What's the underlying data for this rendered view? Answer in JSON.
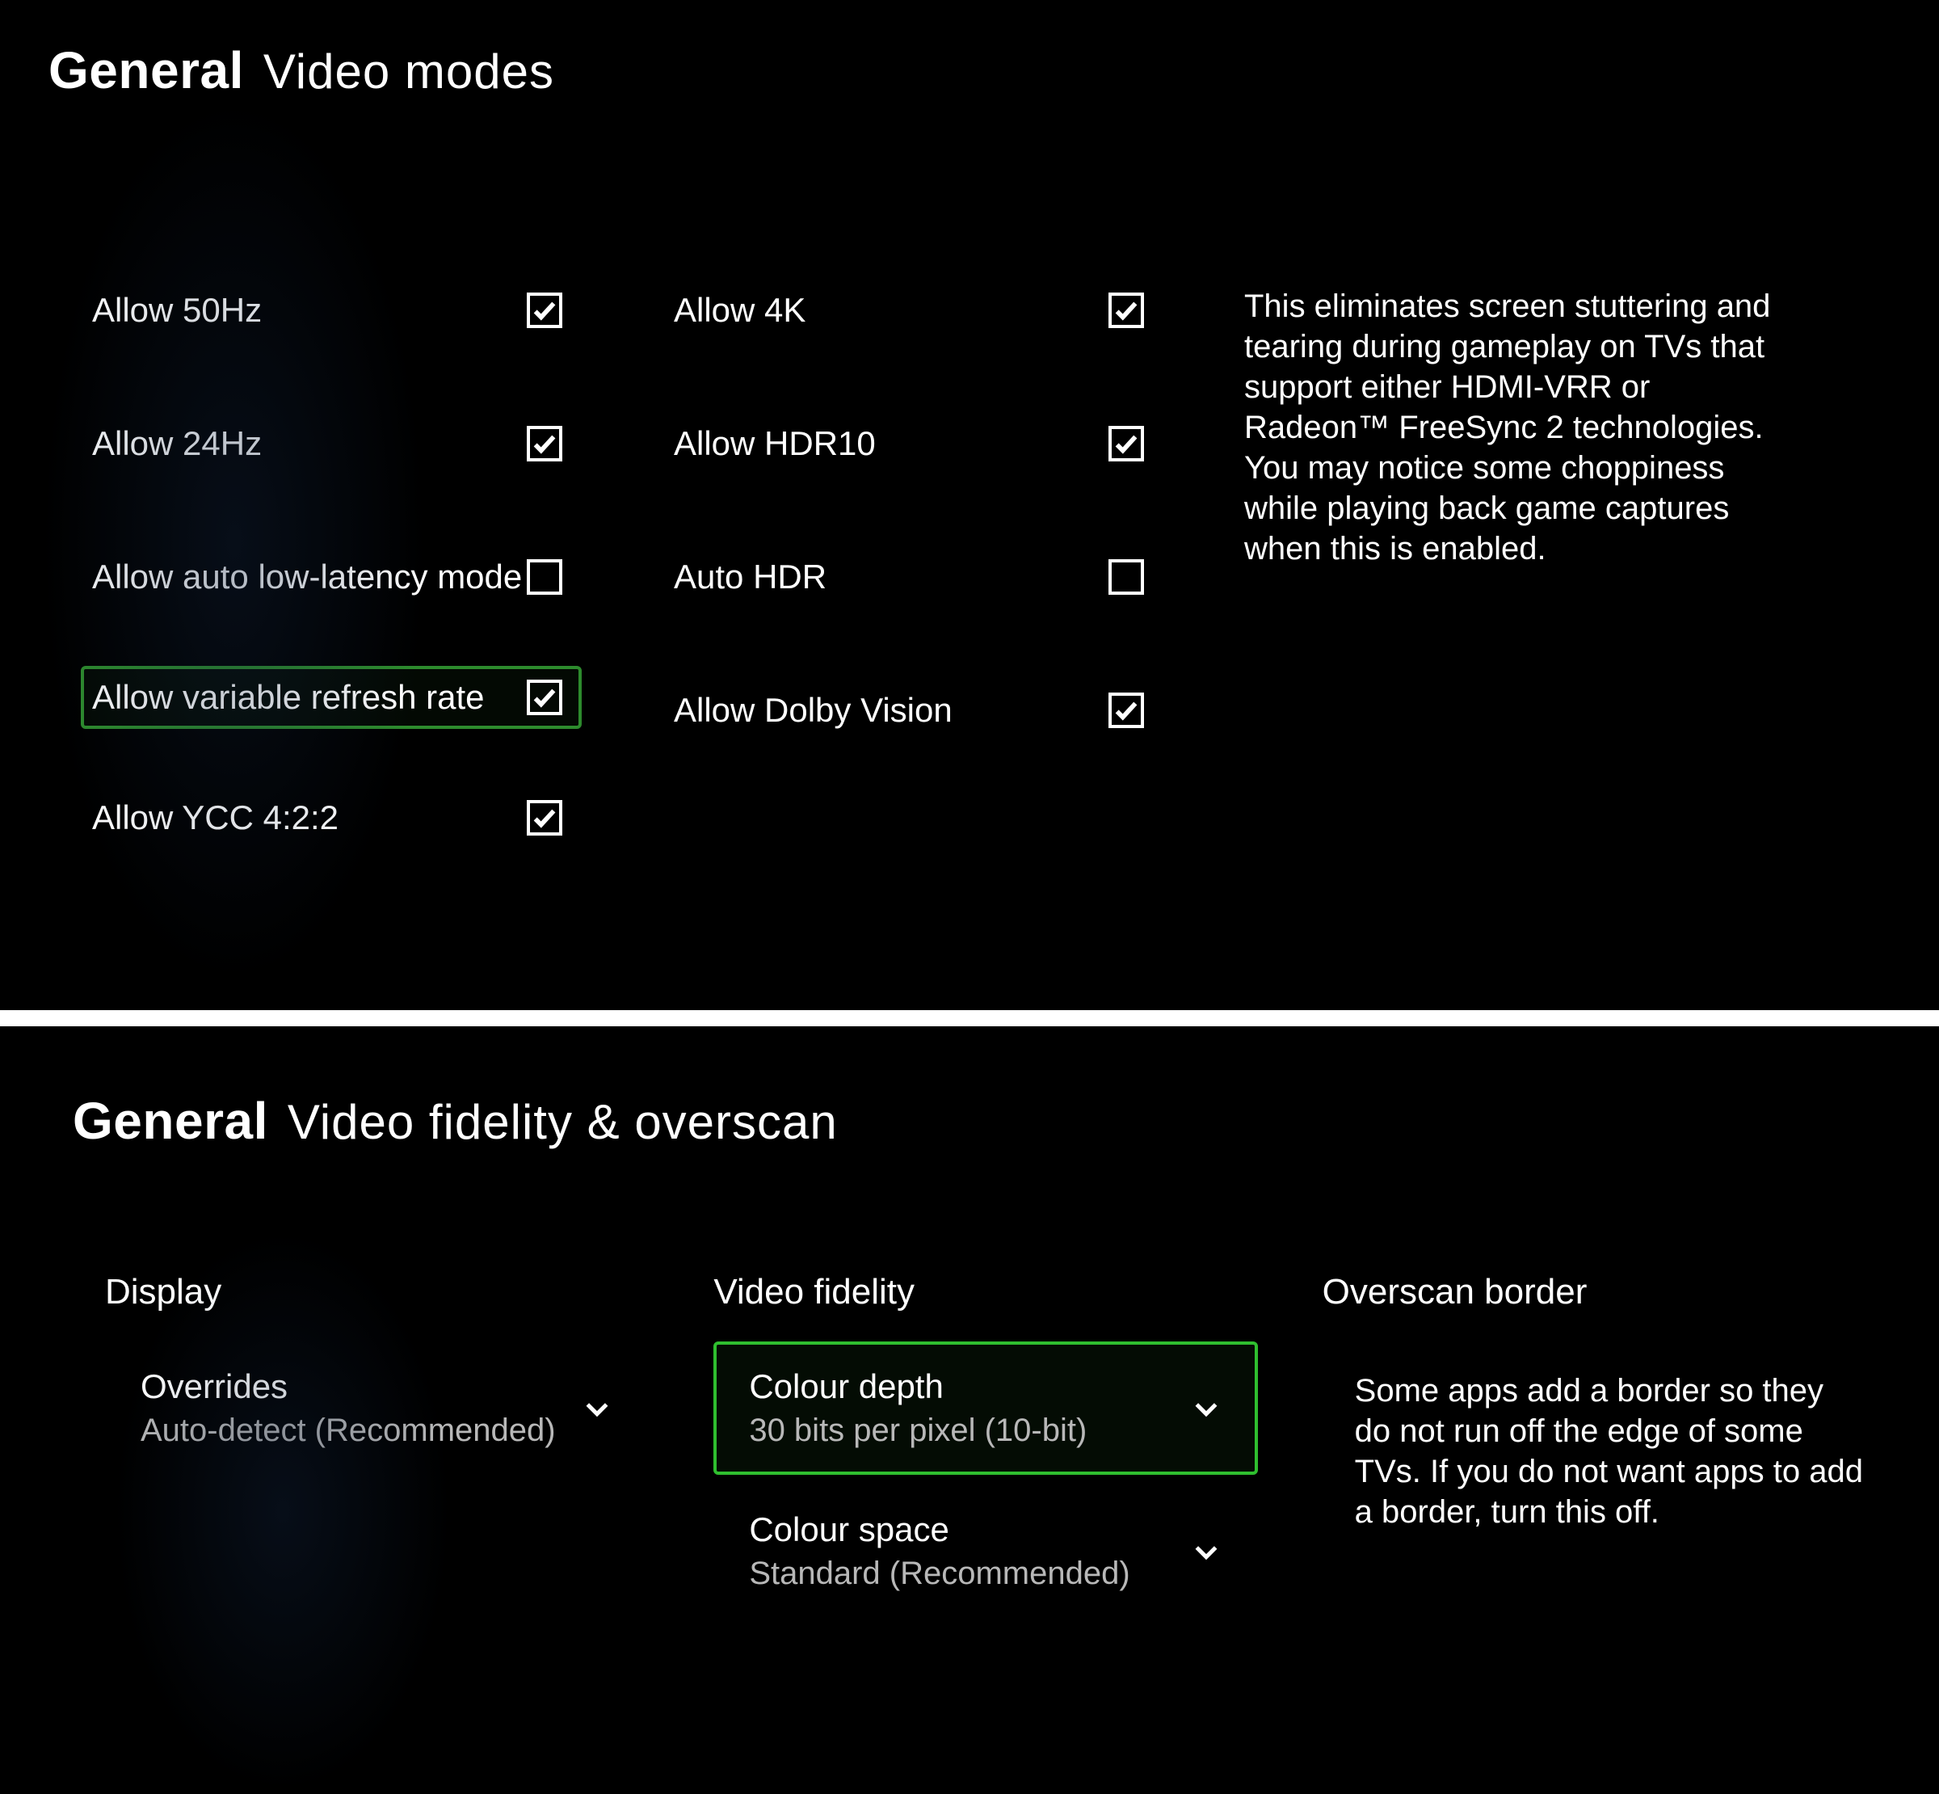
{
  "top": {
    "breadcrumb_main": "General",
    "breadcrumb_sub": "Video modes",
    "col1": [
      {
        "label": "Allow 50Hz",
        "checked": true,
        "highlighted": false
      },
      {
        "label": "Allow 24Hz",
        "checked": true,
        "highlighted": false
      },
      {
        "label": "Allow auto low-latency mode",
        "checked": false,
        "highlighted": false
      },
      {
        "label": "Allow variable refresh rate",
        "checked": true,
        "highlighted": true
      },
      {
        "label": "Allow YCC 4:2:2",
        "checked": true,
        "highlighted": false
      }
    ],
    "col2": [
      {
        "label": "Allow 4K",
        "checked": true,
        "highlighted": false
      },
      {
        "label": "Allow HDR10",
        "checked": true,
        "highlighted": false
      },
      {
        "label": "Auto HDR",
        "checked": false,
        "highlighted": false
      },
      {
        "label": "Allow Dolby Vision",
        "checked": true,
        "highlighted": false
      }
    ],
    "description": "This eliminates screen stuttering and tearing during gameplay on TVs that support either HDMI-VRR or Radeon™ FreeSync 2 technologies. You may notice some choppiness while playing back game captures when this is enabled."
  },
  "bottom": {
    "breadcrumb_main": "General",
    "breadcrumb_sub": "Video fidelity & overscan",
    "display": {
      "title": "Display",
      "overrides": {
        "label": "Overrides",
        "value": "Auto-detect (Recommended)",
        "highlighted": false
      }
    },
    "fidelity": {
      "title": "Video fidelity",
      "colour_depth": {
        "label": "Colour depth",
        "value": "30 bits per pixel (10-bit)",
        "highlighted": true
      },
      "colour_space": {
        "label": "Colour space",
        "value": "Standard (Recommended)",
        "highlighted": false
      }
    },
    "overscan": {
      "title": "Overscan border",
      "description": "Some apps add a border so they do not run off the edge of some TVs. If you do not want apps to add a border, turn this off."
    }
  }
}
